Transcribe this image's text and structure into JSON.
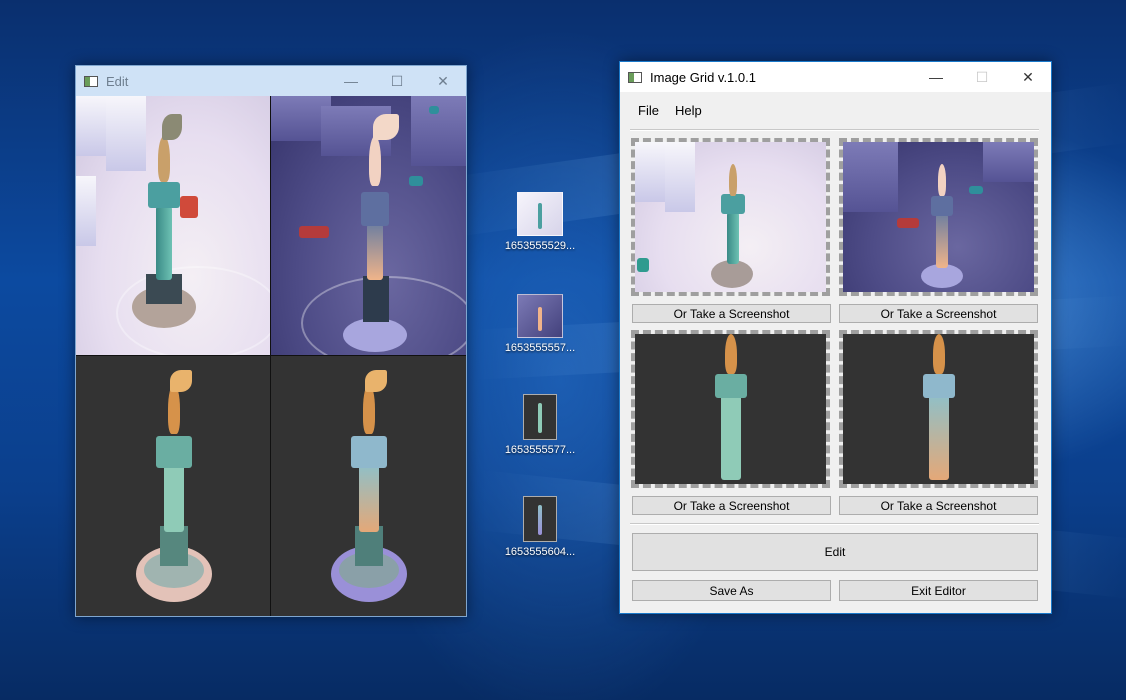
{
  "edit_window": {
    "title": "Edit",
    "controls": {
      "minimize": "—",
      "maximize": "☐",
      "close": "✕"
    }
  },
  "desktop_icons": [
    {
      "label": "1653555529..."
    },
    {
      "label": "1653555557..."
    },
    {
      "label": "1653555577..."
    },
    {
      "label": "1653555604..."
    }
  ],
  "grid_window": {
    "title": "Image Grid v.1.0.1",
    "controls": {
      "minimize": "—",
      "maximize": "☐",
      "close": "✕"
    },
    "menu": {
      "file": "File",
      "help": "Help"
    },
    "screenshot_buttons": [
      "Or Take a Screenshot",
      "Or Take a Screenshot",
      "Or Take a Screenshot",
      "Or Take a Screenshot"
    ],
    "edit_button": "Edit",
    "save_as_button": "Save As",
    "exit_button": "Exit Editor"
  }
}
